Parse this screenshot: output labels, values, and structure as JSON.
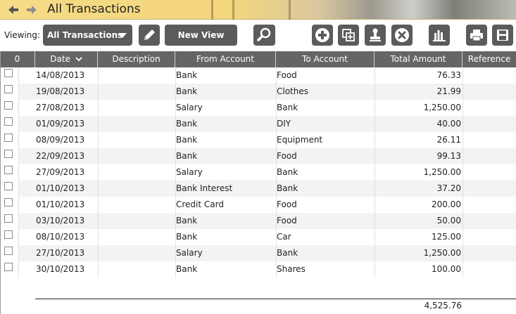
{
  "window": {
    "title": "All Transactions"
  },
  "toolbar": {
    "viewing_label": "Viewing:",
    "view_selected": "All Transactions",
    "new_view_label": "New View",
    "accent": "#5b5b5b"
  },
  "table": {
    "headers": {
      "select": "0",
      "date": "Date",
      "description": "Description",
      "from_account": "From Account",
      "to_account": "To Account",
      "total_amount": "Total Amount",
      "reference": "Reference"
    },
    "rows": [
      {
        "date": "14/08/2013",
        "description": "",
        "from": "Bank",
        "to": "Food",
        "amount": "76.33",
        "reference": ""
      },
      {
        "date": "19/08/2013",
        "description": "",
        "from": "Bank",
        "to": "Clothes",
        "amount": "21.99",
        "reference": ""
      },
      {
        "date": "27/08/2013",
        "description": "",
        "from": "Salary",
        "to": "Bank",
        "amount": "1,250.00",
        "reference": ""
      },
      {
        "date": "01/09/2013",
        "description": "",
        "from": "Bank",
        "to": "DIY",
        "amount": "40.00",
        "reference": ""
      },
      {
        "date": "08/09/2013",
        "description": "",
        "from": "Bank",
        "to": "Equipment",
        "amount": "26.11",
        "reference": ""
      },
      {
        "date": "22/09/2013",
        "description": "",
        "from": "Bank",
        "to": "Food",
        "amount": "99.13",
        "reference": ""
      },
      {
        "date": "27/09/2013",
        "description": "",
        "from": "Salary",
        "to": "Bank",
        "amount": "1,250.00",
        "reference": ""
      },
      {
        "date": "01/10/2013",
        "description": "",
        "from": "Bank Interest",
        "to": "Bank",
        "amount": "37.20",
        "reference": ""
      },
      {
        "date": "01/10/2013",
        "description": "",
        "from": "Credit Card",
        "to": "Food",
        "amount": "200.00",
        "reference": ""
      },
      {
        "date": "03/10/2013",
        "description": "",
        "from": "Bank",
        "to": "Food",
        "amount": "50.00",
        "reference": ""
      },
      {
        "date": "08/10/2013",
        "description": "",
        "from": "Bank",
        "to": "Car",
        "amount": "125.00",
        "reference": ""
      },
      {
        "date": "27/10/2013",
        "description": "",
        "from": "Salary",
        "to": "Bank",
        "amount": "1,250.00",
        "reference": ""
      },
      {
        "date": "30/10/2013",
        "description": "",
        "from": "Bank",
        "to": "Shares",
        "amount": "100.00",
        "reference": ""
      }
    ],
    "total": "4,525.76"
  },
  "icons": {
    "back": "arrow-left-icon",
    "forward": "arrow-right-icon",
    "edit": "pencil-icon",
    "search": "magnifier-icon",
    "add": "plus-circle-icon",
    "duplicate": "copy-plus-icon",
    "stamp": "stamp-icon",
    "delete": "x-circle-icon",
    "chart": "bar-chart-icon",
    "print": "printer-icon",
    "save": "floppy-disk-icon"
  }
}
